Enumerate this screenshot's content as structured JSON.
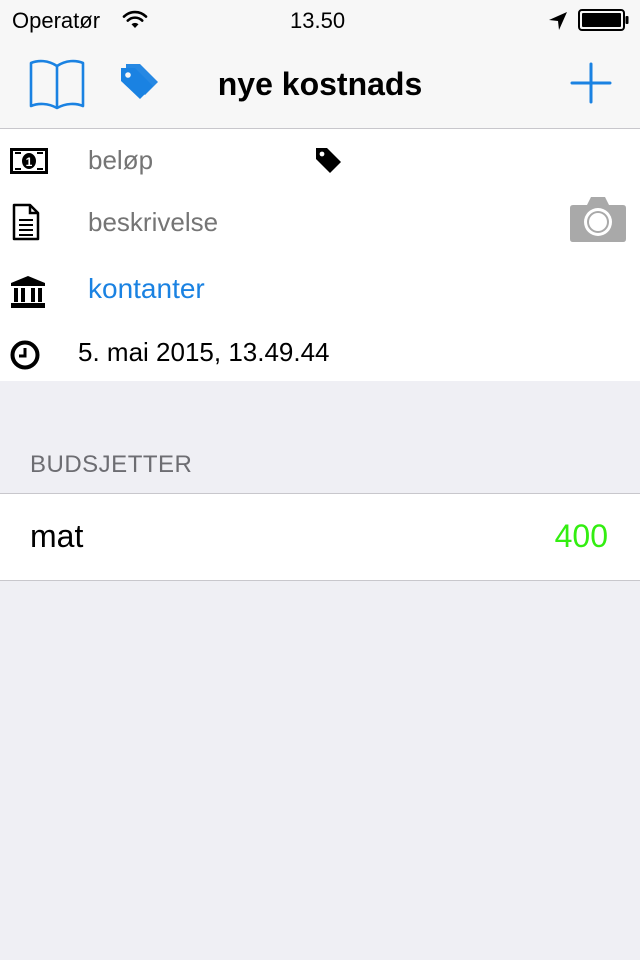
{
  "status_bar": {
    "carrier": "Operatør",
    "time": "13.50",
    "icons": [
      "wifi-icon",
      "location-arrow-icon",
      "battery-icon"
    ]
  },
  "nav": {
    "title": "nye kostnads",
    "left_icons": [
      "book-icon",
      "tags-icon"
    ],
    "right_icon": "plus-icon",
    "accent_color": "#1a82e2"
  },
  "form": {
    "amount_placeholder": "beløp",
    "description_placeholder": "beskrivelse",
    "account": "kontanter",
    "date": "5. mai 2015, 13.49.44",
    "icons": [
      "banknote-icon",
      "tag-icon",
      "document-icon",
      "camera-icon",
      "bank-icon",
      "clock-icon"
    ]
  },
  "budgets": {
    "header": "BUDSJETTER",
    "items": [
      {
        "name": "mat",
        "amount": "400",
        "amount_color": "#33ee11"
      }
    ]
  }
}
